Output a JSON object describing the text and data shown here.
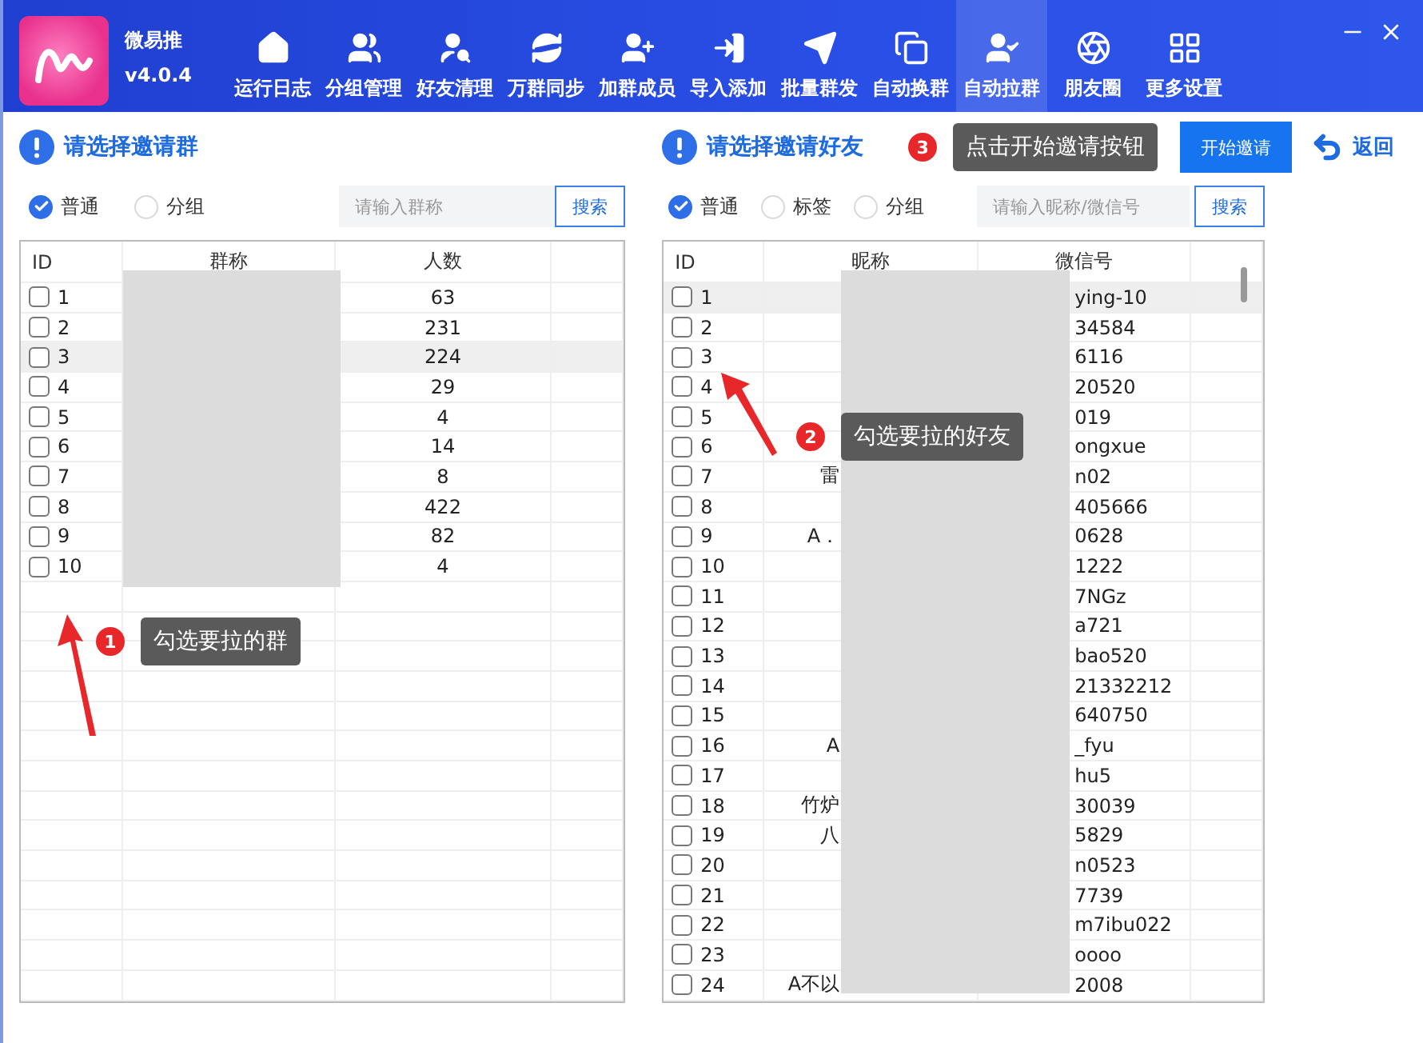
{
  "app": {
    "name": "微易推",
    "version": "v4.0.4"
  },
  "nav": [
    {
      "label": "运行日志",
      "selected": false
    },
    {
      "label": "分组管理",
      "selected": false
    },
    {
      "label": "好友清理",
      "selected": false
    },
    {
      "label": "万群同步",
      "selected": false
    },
    {
      "label": "加群成员",
      "selected": false
    },
    {
      "label": "导入添加",
      "selected": false
    },
    {
      "label": "批量群发",
      "selected": false
    },
    {
      "label": "自动换群",
      "selected": false
    },
    {
      "label": "自动拉群",
      "selected": true
    },
    {
      "label": "朋友圈",
      "selected": false
    },
    {
      "label": "更多设置",
      "selected": false
    }
  ],
  "group_panel": {
    "title": "请选择邀请群",
    "modes": [
      {
        "label": "普通",
        "selected": true
      },
      {
        "label": "分组",
        "selected": false
      }
    ],
    "search": {
      "placeholder": "请输入群称"
    },
    "search_button": "搜索",
    "columns": [
      "ID",
      "群称",
      "人数"
    ],
    "rows": [
      {
        "id": "1",
        "checked": false,
        "selected": false,
        "count": "63"
      },
      {
        "id": "2",
        "checked": false,
        "selected": false,
        "count": "231"
      },
      {
        "id": "3",
        "checked": false,
        "selected": true,
        "count": "224"
      },
      {
        "id": "4",
        "checked": false,
        "selected": false,
        "count": "29"
      },
      {
        "id": "5",
        "checked": false,
        "selected": false,
        "count": "4"
      },
      {
        "id": "6",
        "checked": false,
        "selected": false,
        "count": "14"
      },
      {
        "id": "7",
        "checked": false,
        "selected": false,
        "count": "8"
      },
      {
        "id": "8",
        "checked": false,
        "selected": false,
        "count": "422"
      },
      {
        "id": "9",
        "checked": false,
        "selected": false,
        "count": "82"
      },
      {
        "id": "10",
        "checked": false,
        "selected": false,
        "count": "4"
      }
    ]
  },
  "friend_panel": {
    "title": "请选择邀请好友",
    "modes": [
      {
        "label": "普通",
        "selected": true
      },
      {
        "label": "标签",
        "selected": false
      },
      {
        "label": "分组",
        "selected": false
      }
    ],
    "search": {
      "placeholder": "请输入昵称/微信号"
    },
    "search_button": "搜索",
    "columns": [
      "ID",
      "昵称",
      "微信号"
    ],
    "rows": [
      {
        "id": "1",
        "checked": false,
        "selected": true,
        "wechat_id": "ying-10"
      },
      {
        "id": "2",
        "checked": false,
        "selected": false,
        "wechat_id": "34584"
      },
      {
        "id": "3",
        "checked": false,
        "selected": false,
        "wechat_id": "6116"
      },
      {
        "id": "4",
        "checked": false,
        "selected": false,
        "wechat_id": "20520"
      },
      {
        "id": "5",
        "checked": false,
        "selected": false,
        "wechat_id": "019"
      },
      {
        "id": "6",
        "checked": false,
        "selected": false,
        "wechat_id": "ongxue"
      },
      {
        "id": "7",
        "checked": false,
        "selected": false,
        "nickname": "雷",
        "wechat_id": "n02"
      },
      {
        "id": "8",
        "checked": false,
        "selected": false,
        "wechat_id": "405666"
      },
      {
        "id": "9",
        "checked": false,
        "selected": false,
        "nickname": "A．",
        "wechat_id": "0628"
      },
      {
        "id": "10",
        "checked": false,
        "selected": false,
        "wechat_id": "1222"
      },
      {
        "id": "11",
        "checked": false,
        "selected": false,
        "wechat_id": "7NGz"
      },
      {
        "id": "12",
        "checked": false,
        "selected": false,
        "wechat_id": "a721"
      },
      {
        "id": "13",
        "checked": false,
        "selected": false,
        "wechat_id": "bao520"
      },
      {
        "id": "14",
        "checked": false,
        "selected": false,
        "wechat_id": "21332212"
      },
      {
        "id": "15",
        "checked": false,
        "selected": false,
        "wechat_id": "640750"
      },
      {
        "id": "16",
        "checked": false,
        "selected": false,
        "nickname": "A",
        "wechat_id": "_fyu"
      },
      {
        "id": "17",
        "checked": false,
        "selected": false,
        "wechat_id": "hu5"
      },
      {
        "id": "18",
        "checked": false,
        "selected": false,
        "nickname": "竹炉",
        "wechat_id": "30039"
      },
      {
        "id": "19",
        "checked": false,
        "selected": false,
        "nickname": "八",
        "wechat_id": "5829"
      },
      {
        "id": "20",
        "checked": false,
        "selected": false,
        "wechat_id": "n0523"
      },
      {
        "id": "21",
        "checked": false,
        "selected": false,
        "wechat_id": "7739"
      },
      {
        "id": "22",
        "checked": false,
        "selected": false,
        "wechat_id": "m7ibu022"
      },
      {
        "id": "23",
        "checked": false,
        "selected": false,
        "wechat_id": "oooo"
      },
      {
        "id": "24",
        "checked": false,
        "selected": false,
        "nickname": "A不以",
        "wechat_id": "2008"
      }
    ]
  },
  "start_button": "开始邀请",
  "back_link": "返回",
  "callouts": [
    {
      "number": "1",
      "text": "勾选要拉的群"
    },
    {
      "number": "2",
      "text": "勾选要拉的好友"
    },
    {
      "number": "3",
      "text": "点击开始邀请按钮"
    }
  ]
}
